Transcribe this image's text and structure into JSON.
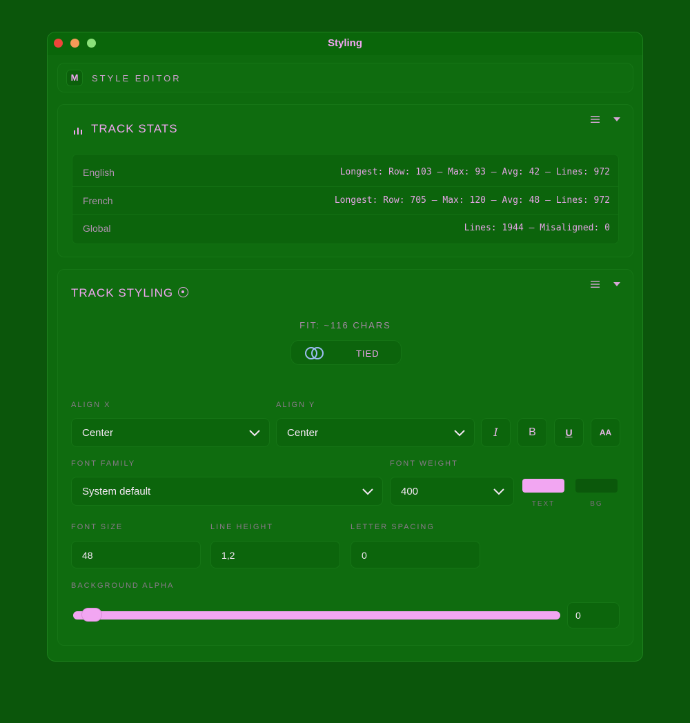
{
  "window": {
    "title": "Styling"
  },
  "header": {
    "badge": "M",
    "title": "STYLE EDITOR"
  },
  "stats": {
    "title": "TRACK STATS",
    "rows": [
      {
        "label": "English",
        "value": "Longest: Row: 103 — Max: 93 — Avg: 42 — Lines: 972"
      },
      {
        "label": "French",
        "value": "Longest: Row: 705 — Max: 120 — Avg: 48 — Lines: 972"
      },
      {
        "label": "Global",
        "value": "Lines: 1944 — Misaligned: 0"
      }
    ]
  },
  "styling": {
    "title": "TRACK STYLING",
    "fit": "FIT: ~116 CHARS",
    "tied_label": "TIED",
    "align_x": {
      "label": "ALIGN X",
      "value": "Center"
    },
    "align_y": {
      "label": "ALIGN Y",
      "value": "Center"
    },
    "format_buttons": {
      "italic": "I",
      "bold": "B",
      "underline": "U",
      "caps": "AA"
    },
    "font_family": {
      "label": "FONT FAMILY",
      "value": "System default"
    },
    "font_weight": {
      "label": "FONT WEIGHT",
      "value": "400"
    },
    "text_color": {
      "label": "TEXT",
      "color": "#f2a6f2"
    },
    "bg_color": {
      "label": "BG",
      "color": "#0b580b"
    },
    "font_size": {
      "label": "FONT SIZE",
      "value": "48"
    },
    "line_height": {
      "label": "LINE HEIGHT",
      "value": "1,2"
    },
    "letter_spacing": {
      "label": "LETTER SPACING",
      "value": "0"
    },
    "background_alpha": {
      "label": "BACKGROUND ALPHA",
      "value": "0",
      "level": 0
    }
  },
  "colors": {
    "accent": "#f2a6f2",
    "background": "#0b560b",
    "panel": "#0e6a0e"
  }
}
